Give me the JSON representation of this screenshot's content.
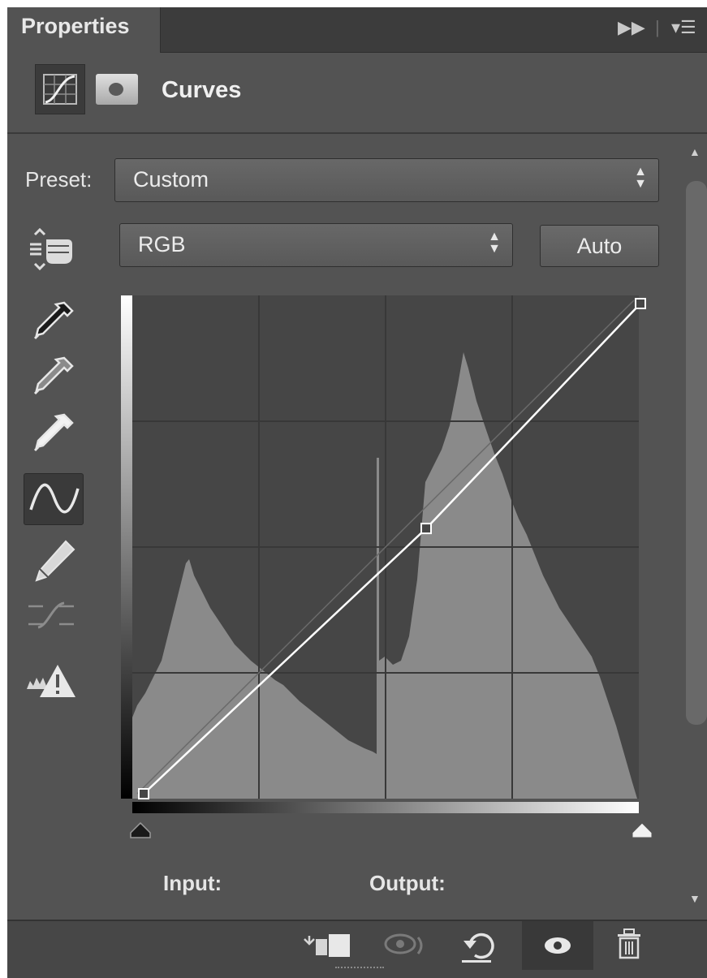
{
  "panel": {
    "tab_label": "Properties",
    "header_title": "Curves",
    "preset_label": "Preset:",
    "preset_value": "Custom",
    "channel_value": "RGB",
    "auto_label": "Auto",
    "input_label": "Input:",
    "output_label": "Output:"
  },
  "tools": [
    {
      "name": "on-image-adjust-icon",
      "active": false
    },
    {
      "name": "sample-black-point-eyedropper-icon",
      "active": false
    },
    {
      "name": "sample-gray-point-eyedropper-icon",
      "active": false
    },
    {
      "name": "sample-white-point-eyedropper-icon",
      "active": false
    },
    {
      "name": "edit-points-curve-icon",
      "active": true
    },
    {
      "name": "draw-pencil-icon",
      "active": false
    },
    {
      "name": "smooth-curve-icon",
      "active": false
    },
    {
      "name": "clipping-warning-icon",
      "active": false
    }
  ],
  "curve": {
    "points": [
      [
        0,
        0
      ],
      [
        145,
        138
      ],
      [
        255,
        255
      ]
    ],
    "range": [
      0,
      255
    ]
  },
  "footer_icons": [
    "clip-to-layer-icon",
    "view-previous-state-icon",
    "reset-icon",
    "visibility-eye-icon",
    "delete-trash-icon"
  ],
  "colors": {
    "panel_bg": "#535353",
    "histogram": "#8a8a8a",
    "graph_bg": "#464646",
    "curve": "#ffffff"
  }
}
